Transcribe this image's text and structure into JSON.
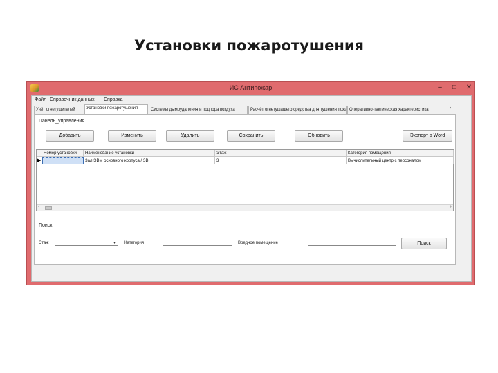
{
  "slide": {
    "title": "Установки пожаротушения"
  },
  "window": {
    "title": "ИС Антипожар",
    "controls": {
      "minimize": "‒",
      "maximize": "□",
      "close": "✕"
    }
  },
  "menu": [
    "Файл",
    "Справочник данных",
    "Справка"
  ],
  "tabs": [
    "Учёт огнетушителей",
    "Установки пожаротушения",
    "Системы дымоудаления и подпора воздуха",
    "Расчёт огнетушащего средства для тушения пожара",
    "Оперативно-тактическая характеристика",
    "›"
  ],
  "panel": {
    "group_label": "Панель_управления",
    "buttons": {
      "add": "Добавить",
      "edit": "Изменить",
      "delete": "Удалить",
      "save": "Сохранить",
      "refresh": "Обновить",
      "export": "Экспорт в Word"
    }
  },
  "grid": {
    "columns": [
      "Номер установки",
      "Наименование установки",
      "Этаж",
      "Категория помещения"
    ],
    "rows": [
      {
        "marker": "▶",
        "cells": [
          "",
          "Зал ЭВМ основного корпуса / ЗВ",
          "3",
          "Вычислительный центр с персоналом"
        ]
      }
    ],
    "scroll_left": "‹",
    "scroll_right": "›"
  },
  "search": {
    "label": "Поиск",
    "fields": [
      "Этаж",
      "Категория",
      "Вредное помещение"
    ],
    "combo_arrow": "▾",
    "button": "Поиск"
  }
}
